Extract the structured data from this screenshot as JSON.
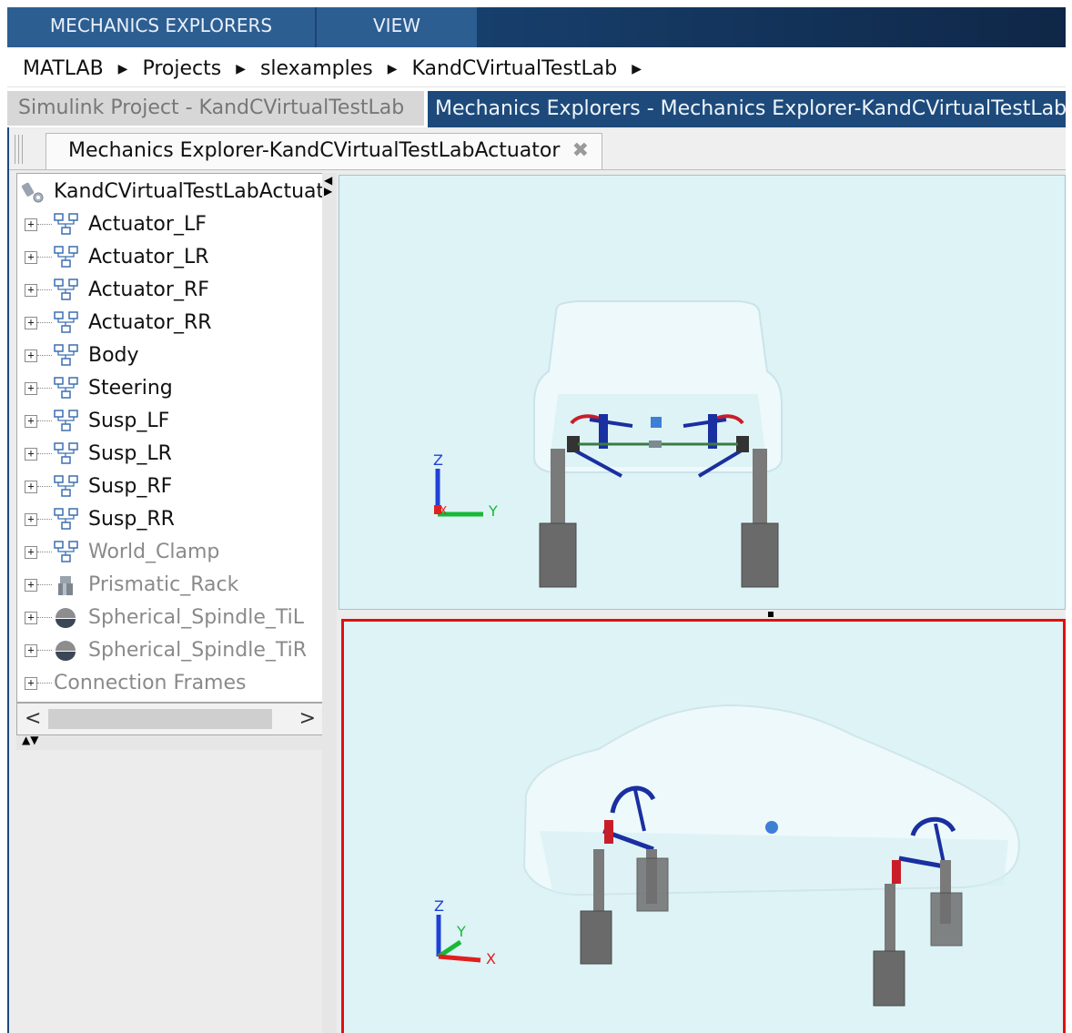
{
  "ribbon": {
    "tabs": [
      {
        "label": "MECHANICS EXPLORERS"
      },
      {
        "label": "VIEW"
      }
    ]
  },
  "breadcrumb": [
    "MATLAB",
    "Projects",
    "slexamples",
    "KandCVirtualTestLab"
  ],
  "document_tabs": [
    {
      "label": "Simulink Project - KandCVirtualTestLab",
      "active": false
    },
    {
      "label": "Mechanics Explorers - Mechanics Explorer-KandCVirtualTestLabAc",
      "active": true
    }
  ],
  "explorer_tab": {
    "label": "Mechanics Explorer-KandCVirtualTestLabActuator",
    "close_icon": "close-icon"
  },
  "tree": {
    "root": "KandCVirtualTestLabActuato",
    "items": [
      {
        "label": "Actuator_LF",
        "icon": "subsystem-icon",
        "enabled": true
      },
      {
        "label": "Actuator_LR",
        "icon": "subsystem-icon",
        "enabled": true
      },
      {
        "label": "Actuator_RF",
        "icon": "subsystem-icon",
        "enabled": true
      },
      {
        "label": "Actuator_RR",
        "icon": "subsystem-icon",
        "enabled": true
      },
      {
        "label": "Body",
        "icon": "subsystem-icon",
        "enabled": true
      },
      {
        "label": "Steering",
        "icon": "subsystem-icon",
        "enabled": true
      },
      {
        "label": "Susp_LF",
        "icon": "subsystem-icon",
        "enabled": true
      },
      {
        "label": "Susp_LR",
        "icon": "subsystem-icon",
        "enabled": true
      },
      {
        "label": "Susp_RF",
        "icon": "subsystem-icon",
        "enabled": true
      },
      {
        "label": "Susp_RR",
        "icon": "subsystem-icon",
        "enabled": true
      },
      {
        "label": "World_Clamp",
        "icon": "subsystem-icon",
        "enabled": false
      },
      {
        "label": "Prismatic_Rack",
        "icon": "prismatic-joint-icon",
        "enabled": false
      },
      {
        "label": "Spherical_Spindle_TiL",
        "icon": "spherical-joint-icon",
        "enabled": false
      },
      {
        "label": "Spherical_Spindle_TiR",
        "icon": "spherical-joint-icon",
        "enabled": false
      },
      {
        "label": "Connection Frames",
        "icon": "",
        "enabled": false
      }
    ]
  },
  "viewports": [
    {
      "name": "front-view",
      "axes": {
        "z": "Z",
        "y": "Y",
        "x": "X"
      },
      "selected": false
    },
    {
      "name": "isometric-view",
      "axes": {
        "z": "Z",
        "y": "Y",
        "x": "X"
      },
      "selected": true
    }
  ],
  "colors": {
    "ribbon_bg": "#1f4f83",
    "active_tab": "#1d4a7b",
    "viewport_bg": "#def3f6",
    "selection_border": "#e01010",
    "suspension": "#1a2fa0",
    "actuator": "#7f7f7f"
  }
}
